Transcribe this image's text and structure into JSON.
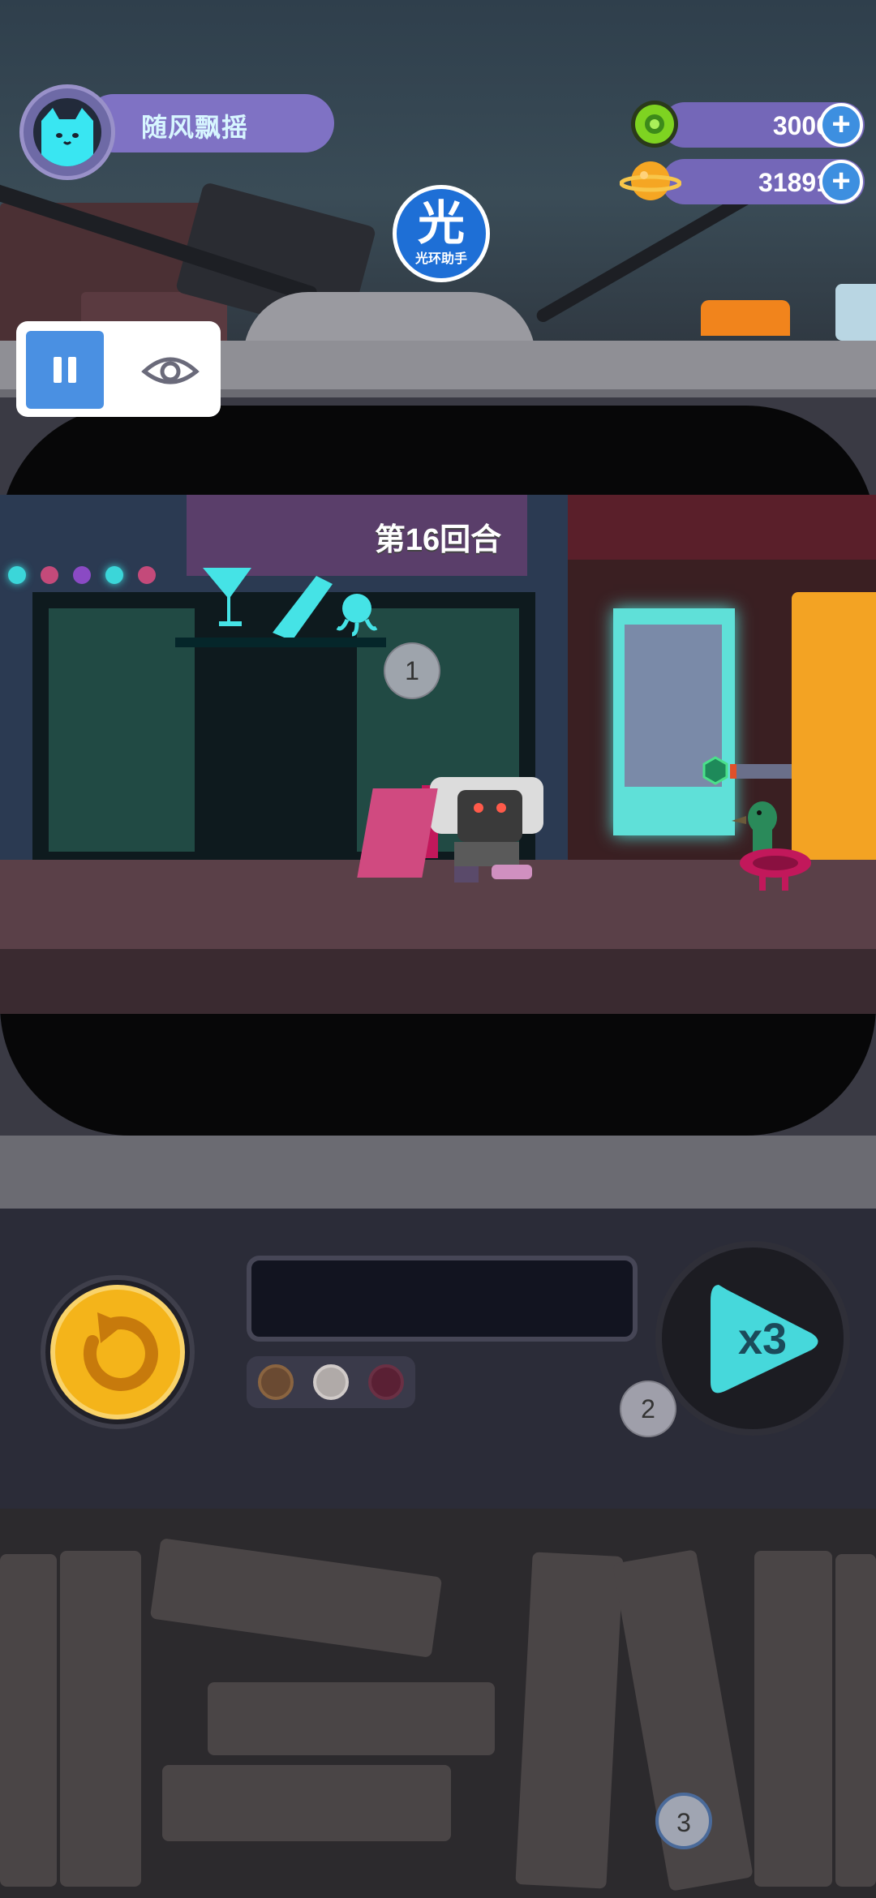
{
  "player": {
    "name": "随风飘摇"
  },
  "currency": {
    "gems": {
      "value": "3006",
      "icon": "green-gem-icon"
    },
    "coins": {
      "value": "31891",
      "icon": "gold-planet-coin-icon"
    }
  },
  "helper": {
    "glyph": "光",
    "label": "光环助手"
  },
  "game": {
    "round": "第16回合"
  },
  "speed": {
    "label": "x3"
  },
  "markers": [
    "1",
    "2",
    "3"
  ],
  "colors": {
    "accent_blue": "#4a90e2",
    "player_bar": "#7f72c4",
    "speed_glow": "#49e3e6",
    "refresh_gold": "#f4b41a"
  }
}
